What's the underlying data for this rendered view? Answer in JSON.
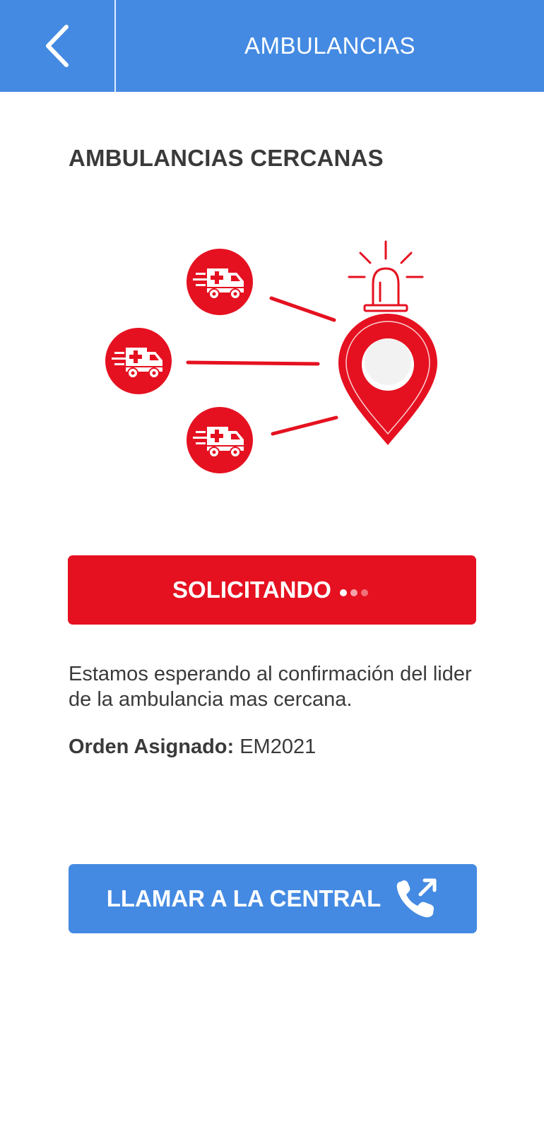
{
  "header": {
    "title": "AMBULANCIAS",
    "back_icon": "chevron-left-icon"
  },
  "section": {
    "title": "AMBULANCIAS CERCANAS"
  },
  "illustration": {
    "ambulance_icon": "ambulance-icon",
    "pin_icon": "location-pin-icon",
    "siren_icon": "siren-icon",
    "accent_color": "#E51120"
  },
  "request_button": {
    "label": "SOLICITANDO",
    "color": "#E51120",
    "dot_colors": [
      "#ffffff",
      "#f5a3aa",
      "#f07079"
    ]
  },
  "message": {
    "text": "Estamos esperando al confirmación del lider de la ambulancia mas cercana."
  },
  "order": {
    "label": "Orden Asignado:",
    "value": "EM2021"
  },
  "call_button": {
    "label": "LLAMAR A LA CENTRAL",
    "icon": "phone-outgoing-icon",
    "color": "#448AE2"
  }
}
